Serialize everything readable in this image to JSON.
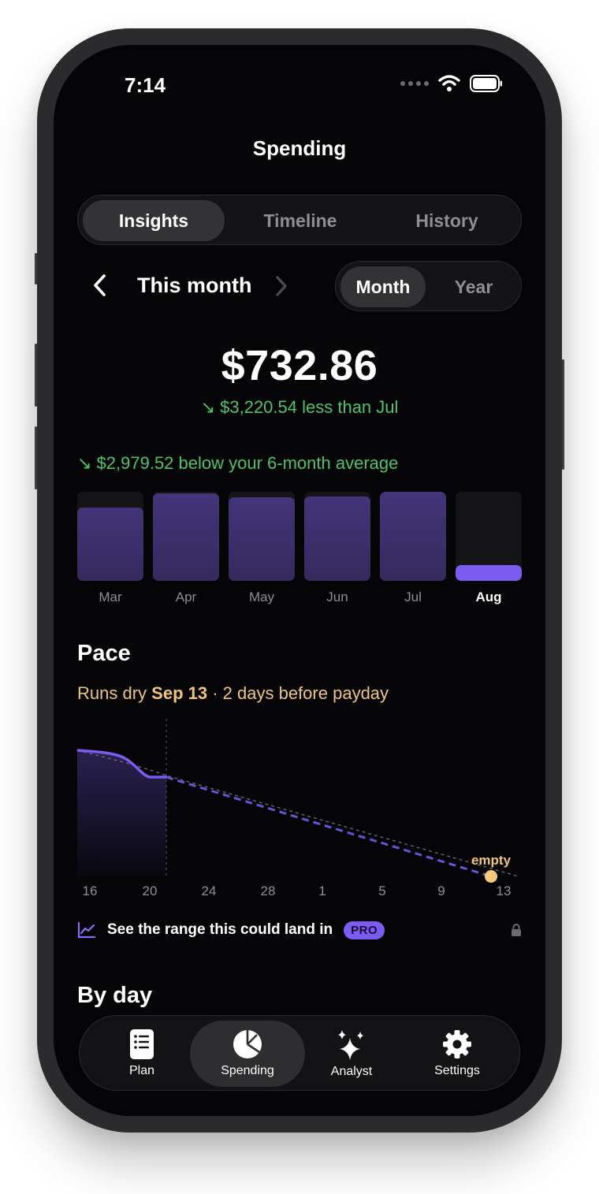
{
  "status": {
    "time": "7:14"
  },
  "header": {
    "title": "Spending"
  },
  "tabs": [
    {
      "label": "Insights",
      "active": true
    },
    {
      "label": "Timeline",
      "active": false
    },
    {
      "label": "History",
      "active": false
    }
  ],
  "period": {
    "label": "This month",
    "granularity": [
      {
        "label": "Month",
        "active": true
      },
      {
        "label": "Year",
        "active": false
      }
    ]
  },
  "summary": {
    "amount": "$732.86",
    "delta": "↘ $3,220.54 less than Jul",
    "average": "↘ $2,979.52 below your 6-month average"
  },
  "monthly_bars": [
    {
      "label": "Mar",
      "level": 0.82,
      "current": false
    },
    {
      "label": "Apr",
      "level": 0.98,
      "current": false
    },
    {
      "label": "May",
      "level": 0.94,
      "current": false
    },
    {
      "label": "Jun",
      "level": 0.95,
      "current": false
    },
    {
      "label": "Jul",
      "level": 1.0,
      "current": false
    },
    {
      "label": "Aug",
      "level": 0.18,
      "current": true
    }
  ],
  "pace": {
    "heading": "Pace",
    "prefix": "Runs dry",
    "date": "Sep 13",
    "suffix": "· 2 days before payday",
    "ticks": [
      "16",
      "20",
      "24",
      "28",
      "1",
      "5",
      "9",
      "13"
    ],
    "empty_label": "empty",
    "range_text": "See the range this could land in",
    "pro_badge": "PRO"
  },
  "by_day": {
    "heading": "By day"
  },
  "tabbar": [
    {
      "label": "Plan",
      "icon": "plan-icon",
      "active": false
    },
    {
      "label": "Spending",
      "icon": "pie-chart-icon",
      "active": true
    },
    {
      "label": "Analyst",
      "icon": "sparkles-icon",
      "active": false
    },
    {
      "label": "Settings",
      "icon": "gear-icon",
      "active": false
    }
  ],
  "colors": {
    "accent": "#7c5cf0",
    "positive": "#4fc26c",
    "warning": "#f0c57a",
    "background": "#050507"
  }
}
